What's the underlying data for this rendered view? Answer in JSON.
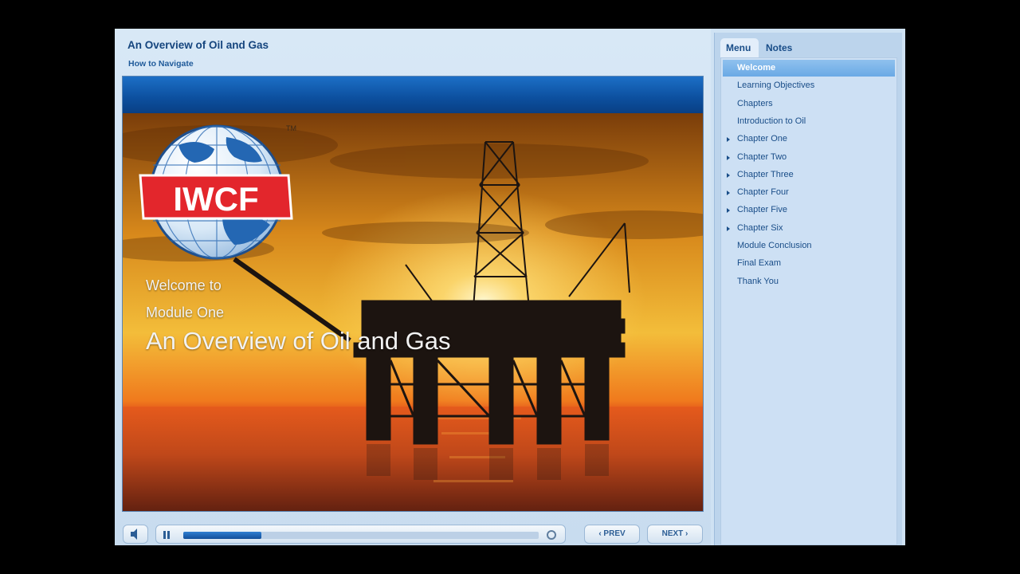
{
  "course": {
    "title": "An Overview of Oil and Gas",
    "nav_help": "How to Navigate"
  },
  "slide": {
    "logo_text": "IWCF",
    "trademark": "TM",
    "welcome_line": "Welcome to",
    "module_line": "Module One",
    "title": "An Overview of Oil and Gas"
  },
  "controls": {
    "prev_label": "‹ PREV",
    "next_label": "NEXT ›",
    "progress": 0.22,
    "icons": [
      "speaker-icon",
      "pause-icon",
      "scrubber-icon"
    ]
  },
  "sidebar": {
    "tabs": [
      {
        "label": "Menu",
        "active": true
      },
      {
        "label": "Notes",
        "active": false
      }
    ],
    "items": [
      {
        "label": "Welcome",
        "active": true,
        "expandable": false
      },
      {
        "label": "Learning Objectives",
        "active": false,
        "expandable": false
      },
      {
        "label": "Chapters",
        "active": false,
        "expandable": false
      },
      {
        "label": "Introduction to Oil",
        "active": false,
        "expandable": false
      },
      {
        "label": "Chapter One",
        "active": false,
        "expandable": true
      },
      {
        "label": "Chapter Two",
        "active": false,
        "expandable": true
      },
      {
        "label": "Chapter Three",
        "active": false,
        "expandable": true
      },
      {
        "label": "Chapter Four",
        "active": false,
        "expandable": true
      },
      {
        "label": "Chapter Five",
        "active": false,
        "expandable": true
      },
      {
        "label": "Chapter Six",
        "active": false,
        "expandable": true
      },
      {
        "label": "Module Conclusion",
        "active": false,
        "expandable": false
      },
      {
        "label": "Final Exam",
        "active": false,
        "expandable": false
      },
      {
        "label": "Thank You",
        "active": false,
        "expandable": false
      }
    ]
  },
  "colors": {
    "accent": "#15457e",
    "slide_bar": "#0c4f9e",
    "active_item": "#6aa9e5",
    "logo_red": "#e3262c"
  }
}
